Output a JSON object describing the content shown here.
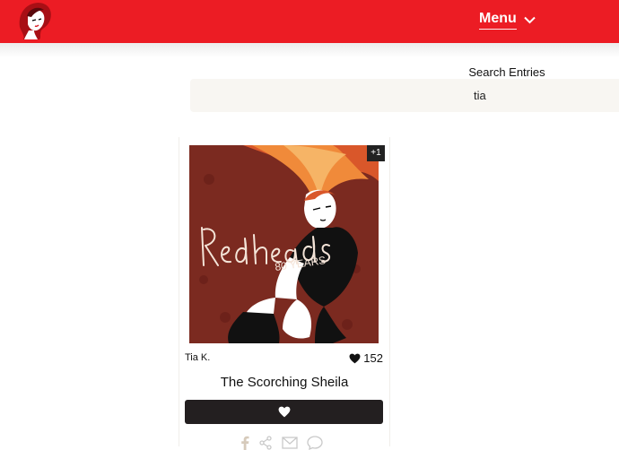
{
  "header": {
    "logo_icon": "redhead-woman-logo",
    "menu_label": "Menu",
    "brand_color": "#ec1c24"
  },
  "search": {
    "label": "Search Entries",
    "value": "tia"
  },
  "entry": {
    "image_count_badge": "+1",
    "artwork_text": [
      "Redheads",
      "80 YEARS"
    ],
    "author": "Tia K.",
    "votes": "152",
    "title": "The Scorching Sheila",
    "vote_button_icon": "heart-icon",
    "share_icons": [
      "facebook-icon",
      "share-icon",
      "email-icon",
      "comment-icon"
    ]
  }
}
